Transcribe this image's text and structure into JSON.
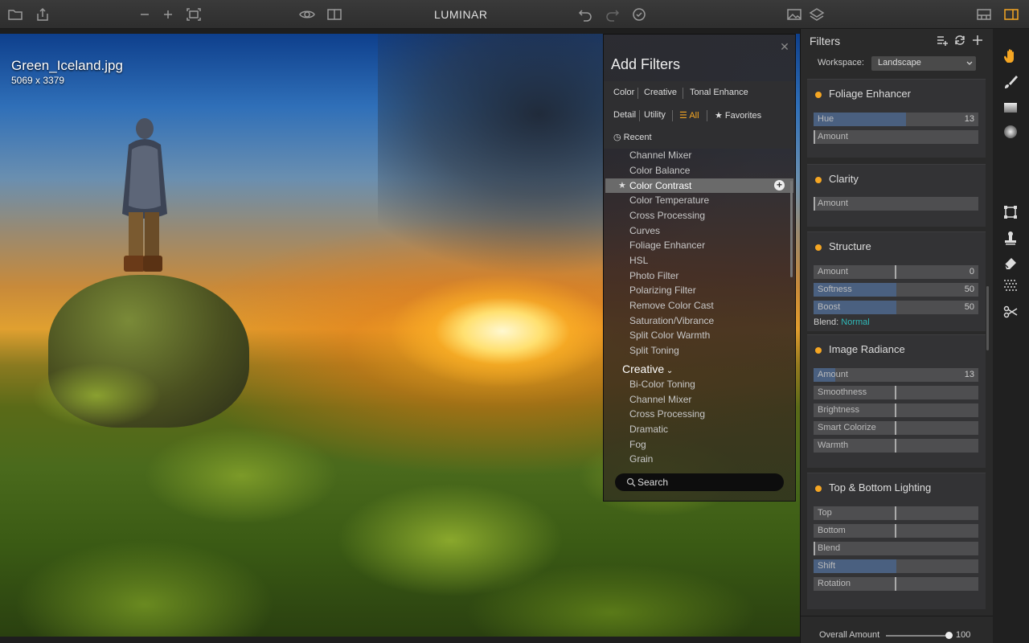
{
  "app": {
    "title": "LUMINAR"
  },
  "image": {
    "filename": "Green_Iceland.jpg",
    "dimensions": "5069 x 3379"
  },
  "toolbar": {
    "icons": [
      "folder-icon",
      "share-icon",
      "zoom-out-icon",
      "zoom-in-icon",
      "fit-screen-icon",
      "preview-eye-icon",
      "compare-split-icon",
      "undo-icon",
      "redo-icon",
      "history-icon",
      "image-library-icon",
      "layers-icon",
      "filmstrip-icon",
      "panel-toggle-icon"
    ]
  },
  "add_filters": {
    "title": "Add Filters",
    "tabs": [
      "Color",
      "Creative",
      "Tonal Enhance",
      "Detail",
      "Utility",
      "All",
      "Favorites",
      "Recent"
    ],
    "active_tab": "All",
    "color_items": [
      "Channel Mixer",
      "Color Balance",
      "Color Contrast",
      "Color Temperature",
      "Cross Processing",
      "Curves",
      "Foliage Enhancer",
      "HSL",
      "Photo Filter",
      "Polarizing Filter",
      "Remove Color Cast",
      "Saturation/Vibrance",
      "Split Color Warmth",
      "Split Toning"
    ],
    "selected_item": "Color Contrast",
    "creative_group": "Creative",
    "creative_items": [
      "Bi-Color Toning",
      "Channel Mixer",
      "Cross Processing",
      "Dramatic",
      "Fog",
      "Grain"
    ],
    "search_placeholder": "Search"
  },
  "filters_panel": {
    "title": "Filters",
    "workspace_label": "Workspace:",
    "workspace_value": "Landscape",
    "cards": [
      {
        "title": "Foliage Enhancer",
        "sliders": [
          {
            "label": "Hue",
            "value": "13",
            "fill": 0.56
          },
          {
            "label": "Amount",
            "value": "",
            "fill": 0
          }
        ]
      },
      {
        "title": "Clarity",
        "sliders": [
          {
            "label": "Amount",
            "value": "",
            "fill": 0
          }
        ]
      },
      {
        "title": "Structure",
        "sliders": [
          {
            "label": "Amount",
            "value": "0",
            "fill": 0.5
          },
          {
            "label": "Softness",
            "value": "50",
            "fill": 0.5
          },
          {
            "label": "Boost",
            "value": "50",
            "fill": 0.5
          }
        ],
        "blend_label": "Blend:",
        "blend_value": "Normal"
      },
      {
        "title": "Image Radiance",
        "sliders": [
          {
            "label": "Amount",
            "value": "13",
            "fill": 0.13
          },
          {
            "label": "Smoothness",
            "value": "",
            "fill": 0.5
          },
          {
            "label": "Brightness",
            "value": "",
            "fill": 0.5
          },
          {
            "label": "Smart Colorize",
            "value": "",
            "fill": 0.5
          },
          {
            "label": "Warmth",
            "value": "",
            "fill": 0.5
          }
        ]
      },
      {
        "title": "Top & Bottom Lighting",
        "sliders": [
          {
            "label": "Top",
            "value": "",
            "fill": 0.5
          },
          {
            "label": "Bottom",
            "value": "",
            "fill": 0.5
          },
          {
            "label": "Blend",
            "value": "",
            "fill": 0
          },
          {
            "label": "Shift",
            "value": "",
            "fill": 0.5
          },
          {
            "label": "Rotation",
            "value": "",
            "fill": 0.5
          }
        ]
      }
    ],
    "overall_label": "Overall Amount",
    "overall_value": "100",
    "overall_fill": 1.0
  },
  "colors": {
    "accent": "#f5a623",
    "blend_value": "#2fb8b8",
    "slider_fill": "#4a6080"
  }
}
